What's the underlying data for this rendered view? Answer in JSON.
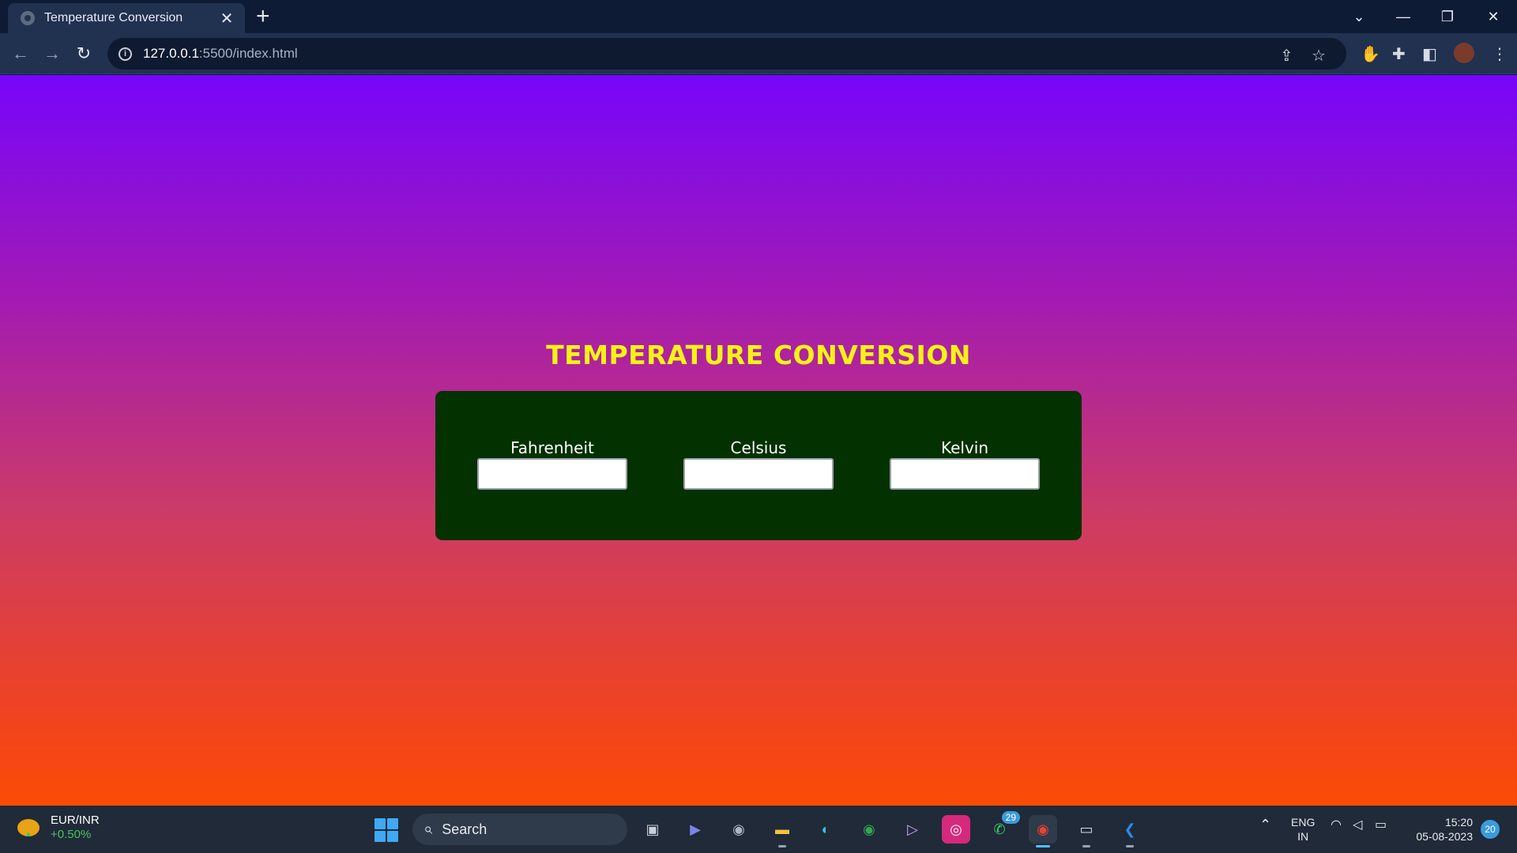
{
  "browser": {
    "tab_title": "Temperature Conversion",
    "tab_close": "✕",
    "new_tab": "+",
    "url_host": "127.0.0.1",
    "url_rest": ":5500/index.html",
    "window_controls": {
      "tab_search": "⌄",
      "minimize": "—",
      "restore": "❐",
      "close": "✕"
    },
    "nav": {
      "back": "←",
      "forward": "→",
      "reload": "↻"
    }
  },
  "page": {
    "title": "TEMPERATURE CONVERSION",
    "fields": [
      {
        "label": "Fahrenheit",
        "value": ""
      },
      {
        "label": "Celsius",
        "value": ""
      },
      {
        "label": "Kelvin",
        "value": ""
      }
    ]
  },
  "taskbar": {
    "widget_pair": "EUR/INR",
    "widget_change": "+0.50%",
    "search_label": "Search",
    "whatsapp_badge": "29",
    "lang_primary": "ENG",
    "lang_secondary": "IN",
    "time": "15:20",
    "date": "05-08-2023",
    "notification_count": "20"
  },
  "colors": {
    "title": "#f7f216",
    "panel": "#033100",
    "gradient_top": "#7705fb",
    "gradient_bottom": "#fb4c05"
  }
}
